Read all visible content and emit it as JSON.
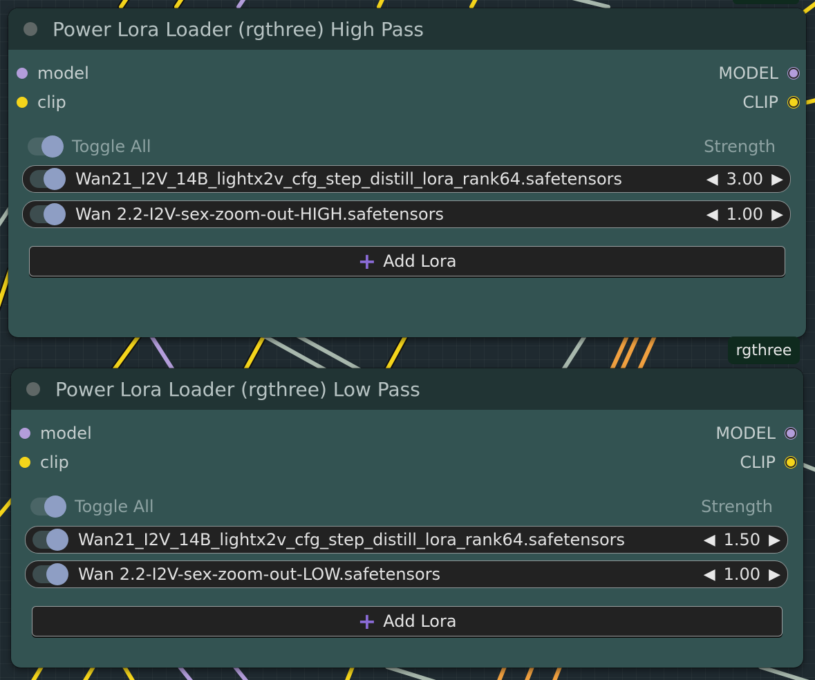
{
  "colors": {
    "model_pin": "#b39ddb",
    "clip_pin": "#f5d51b",
    "node_body": "#335352",
    "node_title": "#213434",
    "canvas": "#1f2a30",
    "badge": "#0f2a1e",
    "add_icon": "#8a6bd6"
  },
  "badge": {
    "label": "rgthree"
  },
  "nodes": [
    {
      "title": "Power Lora Loader (rgthree) High Pass",
      "inputs": [
        "model",
        "clip"
      ],
      "outputs": [
        "MODEL",
        "CLIP"
      ],
      "toggle_all_label": "Toggle All",
      "strength_header": "Strength",
      "loras": [
        {
          "enabled": true,
          "name": "Wan21_I2V_14B_lightx2v_cfg_step_distill_lora_rank64.safetensors",
          "strength": "3.00"
        },
        {
          "enabled": true,
          "name": "Wan 2.2-I2V-sex-zoom-out-HIGH.safetensors",
          "strength": "1.00"
        }
      ],
      "add_label": "Add Lora"
    },
    {
      "title": "Power Lora Loader (rgthree) Low Pass",
      "inputs": [
        "model",
        "clip"
      ],
      "outputs": [
        "MODEL",
        "CLIP"
      ],
      "toggle_all_label": "Toggle All",
      "strength_header": "Strength",
      "loras": [
        {
          "enabled": true,
          "name": "Wan21_I2V_14B_lightx2v_cfg_step_distill_lora_rank64.safetensors",
          "strength": "1.50"
        },
        {
          "enabled": true,
          "name": "Wan 2.2-I2V-sex-zoom-out-LOW.safetensors",
          "strength": "1.00"
        }
      ],
      "add_label": "Add Lora"
    }
  ]
}
